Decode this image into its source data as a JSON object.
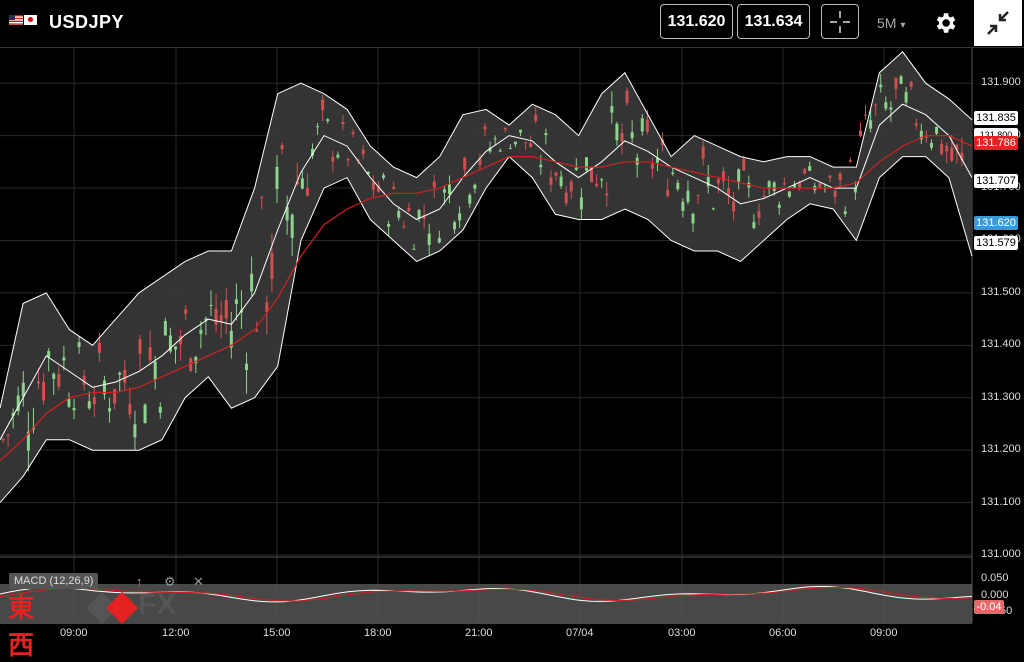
{
  "header": {
    "symbol": "USDJPY",
    "bid": "131.620",
    "ask": "131.634",
    "timeframe": "5M",
    "timeframe_caret": "▾"
  },
  "price_axis": {
    "ticks": [
      "131.900",
      "131.800",
      "131.700",
      "131.600",
      "131.500",
      "131.400",
      "131.300",
      "131.200",
      "131.100",
      "131.000"
    ]
  },
  "tags": {
    "upper_band": "131.835",
    "sma": "131.786",
    "middle_band": "131.707",
    "current": "131.620",
    "lower_band": "131.579",
    "hidden_under": "131.800"
  },
  "macd": {
    "label": "MACD (12,26,9)",
    "ticks": [
      "0.050",
      "0.000",
      "-0.050"
    ],
    "value_tag": "-0.04",
    "icons": [
      "↑",
      "⚙",
      "✕"
    ]
  },
  "time_axis": {
    "ticks": [
      "09:00",
      "12:00",
      "15:00",
      "18:00",
      "21:00",
      "07/04",
      "03:00",
      "06:00",
      "09:00"
    ]
  },
  "logo": {
    "kanji": "東西",
    "fx": "FX"
  },
  "colors": {
    "band_fill": "#3a3a3a",
    "band_line": "#ffffff",
    "sma": "#d42020",
    "bull": "#8bd48b",
    "bear": "#d05050",
    "current_tag": "#3a9ad9"
  },
  "chart_data": {
    "type": "candlestick",
    "ylim": [
      131.0,
      131.95
    ],
    "x_ticks": [
      "09:00",
      "12:00",
      "15:00",
      "18:00",
      "21:00",
      "07/04",
      "03:00",
      "06:00",
      "09:00"
    ],
    "middle_band": [
      131.22,
      131.3,
      131.38,
      131.35,
      131.32,
      131.33,
      131.35,
      131.38,
      131.42,
      131.45,
      131.44,
      131.5,
      131.62,
      131.73,
      131.8,
      131.78,
      131.72,
      131.67,
      131.64,
      131.66,
      131.72,
      131.77,
      131.8,
      131.79,
      131.75,
      131.72,
      131.75,
      131.79,
      131.77,
      131.74,
      131.72,
      131.7,
      131.67,
      131.68,
      131.7,
      131.72,
      131.7,
      131.7,
      131.82,
      131.86,
      131.84,
      131.8,
      131.72
    ],
    "sma": [
      131.18,
      131.22,
      131.27,
      131.3,
      131.31,
      131.31,
      131.32,
      131.34,
      131.36,
      131.38,
      131.4,
      131.43,
      131.49,
      131.57,
      131.63,
      131.66,
      131.68,
      131.69,
      131.69,
      131.7,
      131.72,
      131.74,
      131.76,
      131.76,
      131.75,
      131.74,
      131.74,
      131.75,
      131.75,
      131.74,
      131.73,
      131.72,
      131.71,
      131.7,
      131.7,
      131.7,
      131.7,
      131.71,
      131.75,
      131.78,
      131.8,
      131.8,
      131.78
    ],
    "upper_band": [
      131.28,
      131.48,
      131.5,
      131.43,
      131.4,
      131.45,
      131.5,
      131.53,
      131.56,
      131.58,
      131.58,
      131.7,
      131.88,
      131.9,
      131.88,
      131.85,
      131.78,
      131.74,
      131.72,
      131.76,
      131.84,
      131.85,
      131.82,
      131.86,
      131.84,
      131.8,
      131.88,
      131.92,
      131.84,
      131.76,
      131.8,
      131.78,
      131.76,
      131.75,
      131.76,
      131.76,
      131.74,
      131.74,
      131.92,
      131.96,
      131.9,
      131.87,
      131.83
    ],
    "lower_band": [
      131.1,
      131.15,
      131.22,
      131.22,
      131.2,
      131.2,
      131.2,
      131.22,
      131.3,
      131.34,
      131.28,
      131.3,
      131.36,
      131.6,
      131.7,
      131.72,
      131.64,
      131.6,
      131.56,
      131.58,
      131.62,
      131.7,
      131.76,
      131.72,
      131.65,
      131.64,
      131.64,
      131.66,
      131.64,
      131.6,
      131.58,
      131.58,
      131.56,
      131.6,
      131.64,
      131.67,
      131.66,
      131.6,
      131.72,
      131.76,
      131.76,
      131.72,
      131.57
    ]
  }
}
